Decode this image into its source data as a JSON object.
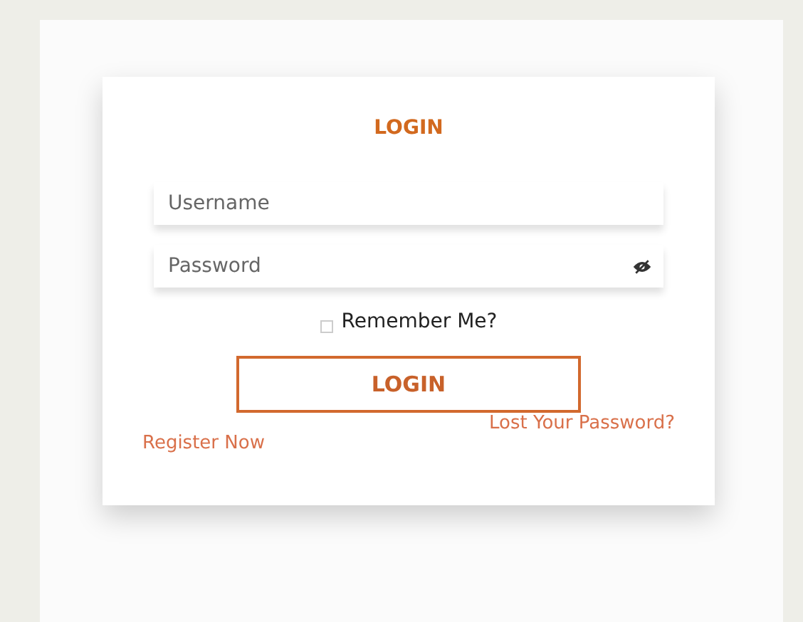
{
  "login_form": {
    "title": "LOGIN",
    "fields": [
      {
        "placeholder": "Username",
        "kind": "text"
      },
      {
        "placeholder": "Password",
        "kind": "password"
      }
    ],
    "remember_me": {
      "label": "Remember Me?",
      "checked": false
    },
    "submit_button": "LOGIN",
    "links": [
      "Register Now",
      "Lost Your Password?"
    ]
  }
}
